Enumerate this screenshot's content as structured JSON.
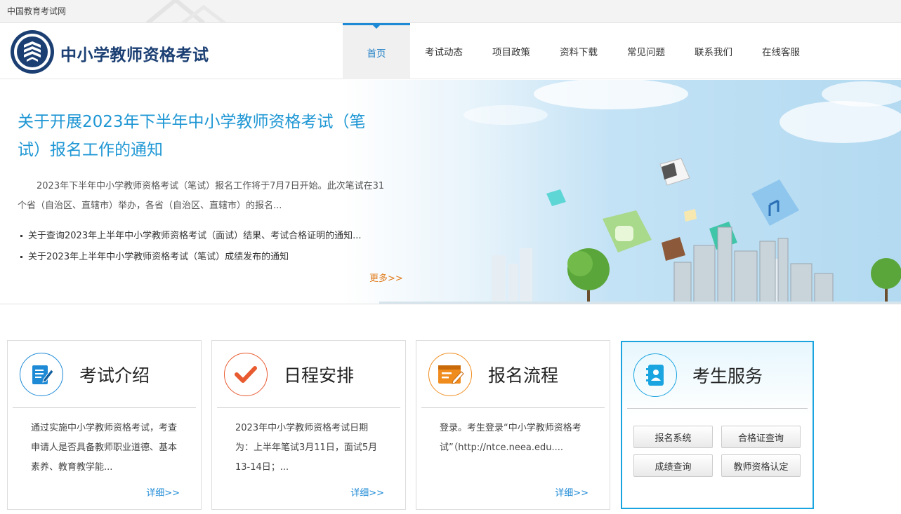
{
  "topbar": {
    "site_link": "中国教育考试网"
  },
  "header": {
    "title": "中小学教师资格考试",
    "nav": [
      "首页",
      "考试动态",
      "项目政策",
      "资料下载",
      "常见问题",
      "联系我们",
      "在线客服"
    ],
    "active_nav": "首页"
  },
  "banner": {
    "headline": "关于开展2023年下半年中小学教师资格考试（笔试）报名工作的通知",
    "summary": "2023年下半年中小学教师资格考试（笔试）报名工作将于7月7日开始。此次笔试在31个省（自治区、直辖市）举办，各省（自治区、直辖市）的报名...",
    "news": [
      "关于查询2023年上半年中小学教师资格考试（面试）结果、考试合格证明的通知...",
      "关于2023年上半年中小学教师资格考试（笔试）成绩发布的通知"
    ],
    "more": "更多>>"
  },
  "cards": [
    {
      "title": "考试介绍",
      "icon": "document-edit-icon",
      "color": "#1e8ad6",
      "text": "通过实施中小学教师资格考试，考查申请人是否具备教师职业道德、基本素养、教育教学能...",
      "detail": "详细>>"
    },
    {
      "title": "日程安排",
      "icon": "checkmark-icon",
      "color": "#e85a2f",
      "text": "2023年中小学教师资格考试日期为：上半年笔试3月11日，面试5月13-14日；...",
      "detail": "详细>>"
    },
    {
      "title": "报名流程",
      "icon": "form-window-icon",
      "color": "#f08c1e",
      "text": "登录。考生登录“中小学教师资格考试”（http://ntce.neea.edu....",
      "detail": "详细>>"
    }
  ],
  "service": {
    "title": "考生服务",
    "icon": "address-book-icon",
    "color": "#1aa4e0",
    "buttons": [
      "报名系统",
      "合格证查询",
      "成绩查询",
      "教师资格认定"
    ]
  }
}
